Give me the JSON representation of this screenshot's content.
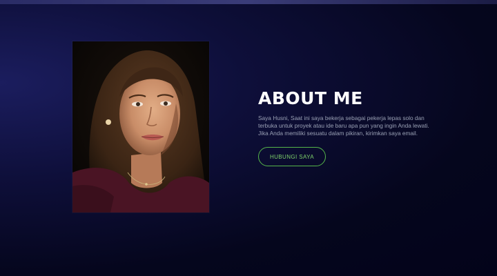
{
  "about": {
    "heading": "ABOUT ME",
    "description": "Saya Husni, Saat ini saya bekerja sebagai pekerja lepas solo dan terbuka untuk proyek atau ide baru apa pun yang ingin Anda lewati. Jika Anda memiliki sesuatu dalam pikiran, kirimkan saya email.",
    "button_label": "HUBUNGI SAYA"
  },
  "colors": {
    "background": "#05061d",
    "accent": "#56b64a",
    "text": "#9aa1b5"
  }
}
